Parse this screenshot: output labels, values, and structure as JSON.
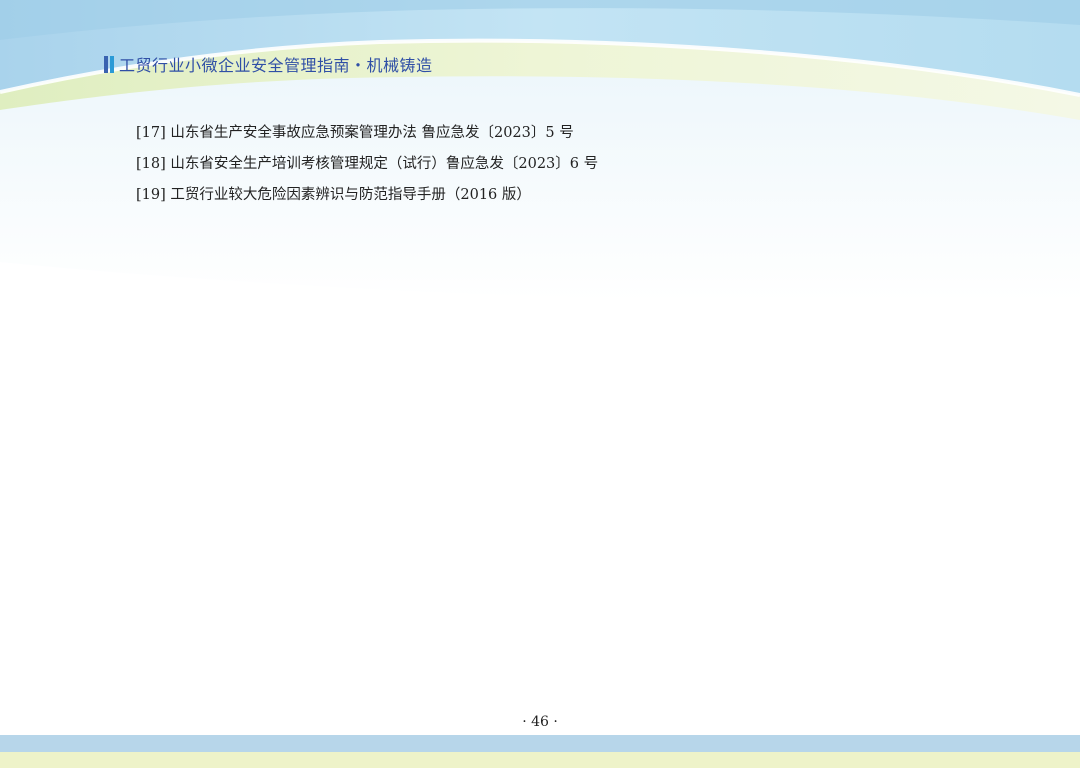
{
  "header": {
    "title": "工贸行业小微企业安全管理指南・机械铸造"
  },
  "references": [
    "[17] 山东省生产安全事故应急预案管理办法 鲁应急发〔2023〕5 号",
    "[18] 山东省安全生产培训考核管理规定（试行）鲁应急发〔2023〕6 号",
    "[19] 工贸行业较大危险因素辨识与防范指导手册（2016 版）"
  ],
  "footer": {
    "page_number": "· 46 ·"
  },
  "colors": {
    "header_text": "#2f4fa6",
    "wave_blue": "#b9dff2",
    "wave_green": "#e9f2c8",
    "footer_blue": "#b7d6ea",
    "footer_green": "#eef3c9"
  }
}
